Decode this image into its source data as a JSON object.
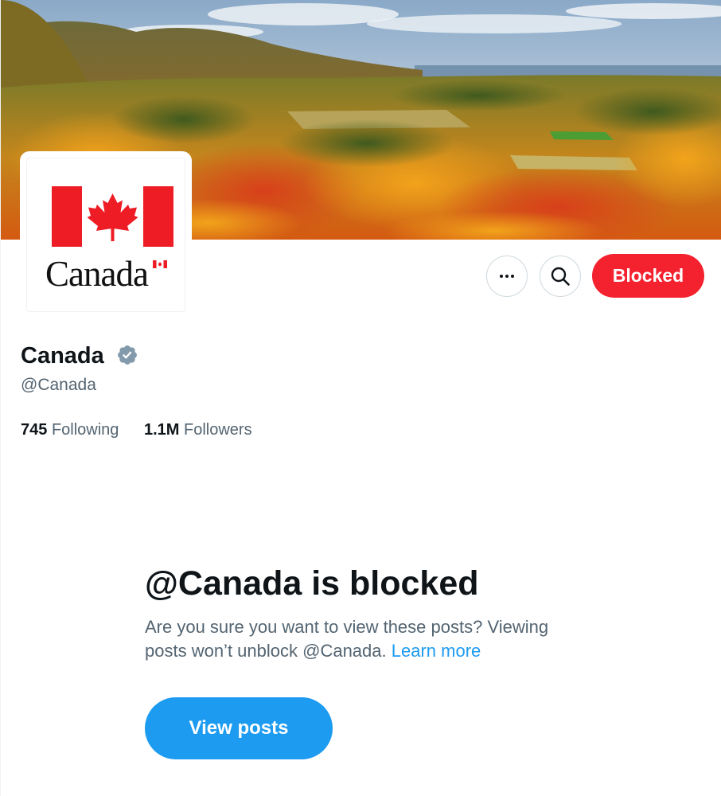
{
  "profile": {
    "display_name": "Canada",
    "handle": "@Canada",
    "avatar_wordmark": "Canada",
    "verified": true,
    "following_count": "745",
    "following_label": "Following",
    "followers_count": "1.1M",
    "followers_label": "Followers"
  },
  "actions": {
    "more_icon": "more-horizontal-icon",
    "search_icon": "search-icon",
    "blocked_label": "Blocked"
  },
  "blocked_notice": {
    "title": "@Canada is blocked",
    "description": "Are you sure you want to view these posts? Viewing posts won’t unblock @Canada.",
    "learn_more": "Learn more",
    "view_posts_label": "View posts"
  },
  "colors": {
    "blocked_red": "#f4212e",
    "primary_blue": "#1d9bf0",
    "verified_gray": "#829aab",
    "flag_red": "#ee1c25",
    "text_primary": "#0f1419",
    "text_secondary": "#536471"
  }
}
